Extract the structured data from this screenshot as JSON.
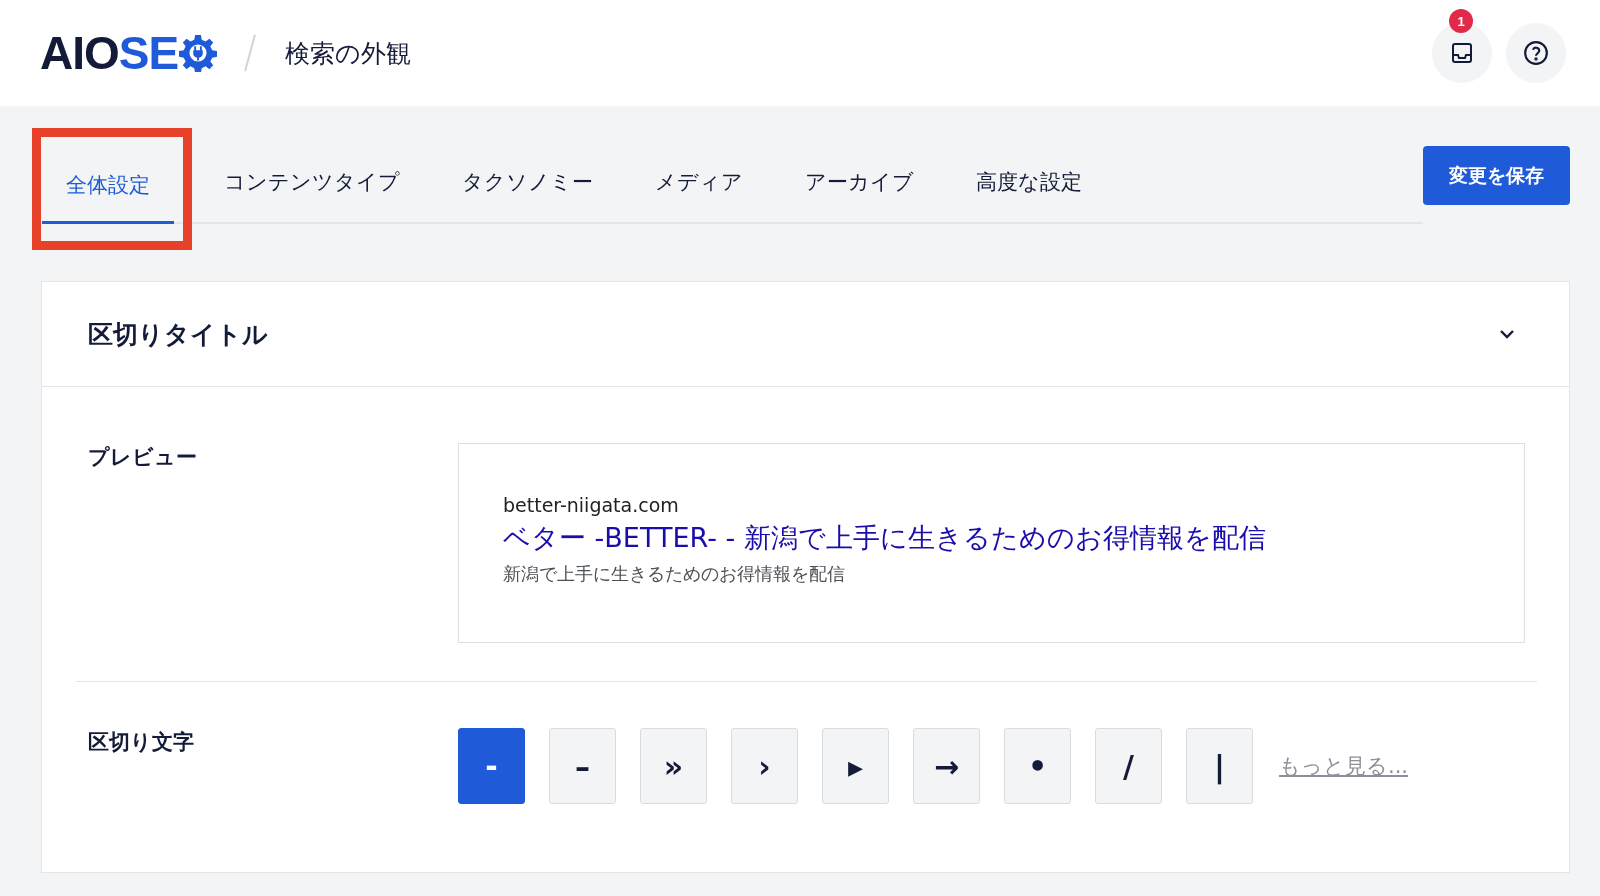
{
  "header": {
    "logo_dark": "AIO",
    "logo_blue": "SE",
    "title": "検索の外観",
    "notification_count": "1"
  },
  "tabs": [
    {
      "label": "全体設定",
      "selected": true,
      "highlighted": true
    },
    {
      "label": "コンテンツタイプ",
      "selected": false,
      "highlighted": false
    },
    {
      "label": "タクソノミー",
      "selected": false,
      "highlighted": false
    },
    {
      "label": "メディア",
      "selected": false,
      "highlighted": false
    },
    {
      "label": "アーカイブ",
      "selected": false,
      "highlighted": false
    },
    {
      "label": "高度な設定",
      "selected": false,
      "highlighted": false
    }
  ],
  "save_button": "変更を保存",
  "card": {
    "title": "区切りタイトル",
    "expanded": true,
    "preview": {
      "label": "プレビュー",
      "url": "better-niigata.com",
      "headline": "ベター -BETTER- - 新潟で上手に生きるためのお得情報を配信",
      "description": "新潟で上手に生きるためのお得情報を配信"
    },
    "separator": {
      "label": "区切り文字",
      "options": [
        {
          "symbol": "-",
          "selected": true
        },
        {
          "symbol": "–",
          "selected": false
        },
        {
          "symbol": "»",
          "selected": false
        },
        {
          "symbol": "›",
          "selected": false
        },
        {
          "symbol": "▸",
          "selected": false
        },
        {
          "symbol": "→",
          "selected": false
        },
        {
          "symbol": "•",
          "selected": false
        },
        {
          "symbol": "/",
          "selected": false
        },
        {
          "symbol": "|",
          "selected": false
        }
      ],
      "more_link": "もっと見る..."
    }
  }
}
